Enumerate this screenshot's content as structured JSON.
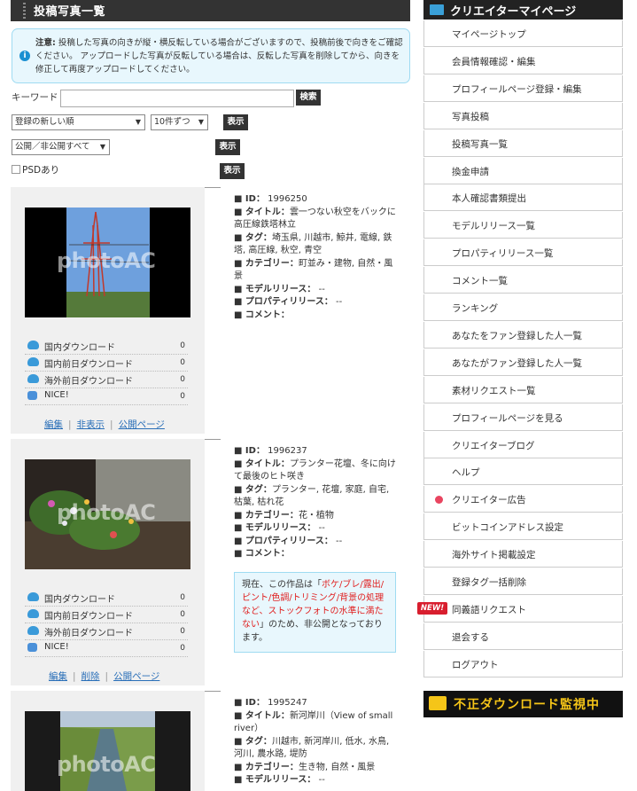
{
  "header": {
    "title": "投稿写真一覧"
  },
  "notice": {
    "label": "注意:",
    "text": "投稿した写真の向きが縦・横反転している場合がございますので、投稿前後で向きをご確認ください。 アップロードした写真が反転している場合は、反転した写真を削除してから、向きを修正して再度アップロードしてください。"
  },
  "search": {
    "keyword_label": "キーワード",
    "keyword_value": "",
    "search_button": "検索",
    "sort_select": "登録の新しい順",
    "per_page_select": "10件ずつ",
    "visibility_select": "公開／非公開すべて",
    "psd_label": "PSDあり",
    "show_button": "表示"
  },
  "stat_labels": [
    "国内ダウンロード",
    "国内前日ダウンロード",
    "海外前日ダウンロード",
    "NICE!"
  ],
  "watermark": "photoAC",
  "meta_labels": {
    "id": "■ ID：",
    "title": "■ タイトル：",
    "tag": "■ タグ：",
    "category": "■ カテゴリー：",
    "model": "■ モデルリリース：",
    "property": "■ プロパティリリース：",
    "comment": "■ コメント："
  },
  "items": [
    {
      "id": "1996250",
      "title": "雲一つない秋空をバックに高圧線鉄塔林立",
      "tags": "埼玉県, 川越市, 鯨井, 電線, 鉄塔, 高圧線, 秋空, 青空",
      "category": "町並み・建物, 自然・風景",
      "model_release": "--",
      "property_release": "--",
      "comment": "",
      "stats": [
        "0",
        "0",
        "0",
        "0"
      ],
      "links": [
        "編集",
        "非表示",
        "公開ページ"
      ]
    },
    {
      "id": "1996237",
      "title": "プランター花壇、冬に向けて最後のヒト咲き",
      "tags": "プランター, 花壇, 家庭, 自宅, 枯葉, 枯れ花",
      "category": "花・植物",
      "model_release": "--",
      "property_release": "--",
      "comment": "",
      "stats": [
        "0",
        "0",
        "0",
        "0"
      ],
      "links": [
        "編集",
        "削除",
        "公開ページ"
      ],
      "alert": {
        "pre": "現在、この作品は「",
        "red": "ボケ/ブレ/露出/ピント/色調/トリミング/背景の処理など、ストックフォトの水準に満たない",
        "post": "」のため、非公開となっております。"
      }
    },
    {
      "id": "1995247",
      "title": "新河岸川（View of small river）",
      "tags": "川越市, 新河岸川, 低水, 水鳥, 河川, 農水路, 堤防",
      "category": "生き物, 自然・風景",
      "model_release": "--"
    }
  ],
  "sidebar": {
    "title": "クリエイターマイページ",
    "items": [
      "マイページトップ",
      "会員情報確認・編集",
      "プロフィールページ登録・編集",
      "写真投稿",
      "投稿写真一覧",
      "換金申請",
      "本人確認書類提出",
      "モデルリリース一覧",
      "プロパティリリース一覧",
      "コメント一覧",
      "ランキング",
      "あなたをファン登録した人一覧",
      "あなたがファン登録した人一覧",
      "素材リクエスト一覧",
      "プロフィールページを見る",
      "クリエイターブログ",
      "ヘルプ",
      "クリエイター広告",
      "ビットコインアドレス設定",
      "海外サイト掲載設定",
      "登録タグ一括削除",
      "同義語リクエスト",
      "退会する",
      "ログアウト"
    ],
    "new_badge": "NEW!",
    "banner": "不正ダウンロード監視中"
  }
}
